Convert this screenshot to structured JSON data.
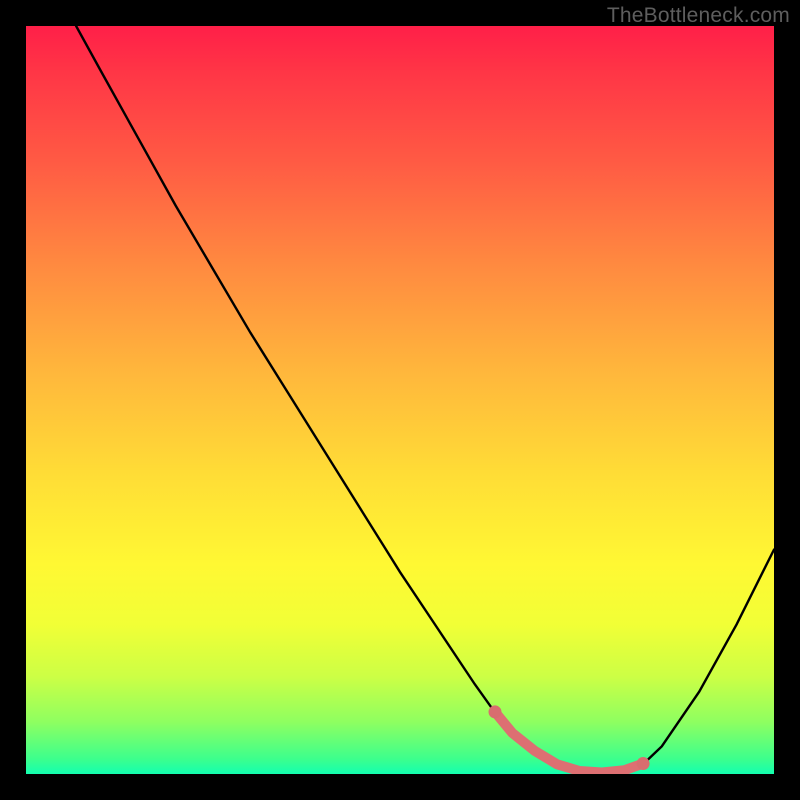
{
  "attribution": "TheBottleneck.com",
  "colors": {
    "background": "#000000",
    "gradient_top": "#ff1f48",
    "gradient_mid": "#ffdd36",
    "gradient_bottom": "#13ffb0",
    "curve_stroke": "#000000",
    "marker_stroke": "#dd6f72",
    "marker_fill_dot": "#d86d6f"
  },
  "chart_data": {
    "type": "line",
    "title": "",
    "xlabel": "",
    "ylabel": "",
    "xlim": [
      0,
      100
    ],
    "ylim": [
      0,
      100
    ],
    "series": [
      {
        "name": "bottleneck-curve",
        "x": [
          6.7,
          10,
          15,
          20,
          25,
          30,
          35,
          40,
          45,
          50,
          55,
          60,
          62.5,
          65,
          70,
          73,
          75,
          77,
          80,
          82.7,
          85,
          90,
          95,
          100
        ],
        "values": [
          100,
          94,
          85,
          76,
          67.5,
          59,
          51,
          43,
          35,
          27,
          19.5,
          12,
          8.5,
          5.5,
          1.8,
          0.6,
          0.2,
          0.2,
          0.5,
          1.5,
          3.7,
          11,
          20,
          30
        ]
      }
    ],
    "markers": {
      "name": "highlight-band",
      "x": [
        62.7,
        65,
        68,
        71,
        74,
        77,
        80,
        82.5
      ],
      "values": [
        8.3,
        5.5,
        3.1,
        1.3,
        0.4,
        0.2,
        0.5,
        1.4
      ]
    }
  }
}
